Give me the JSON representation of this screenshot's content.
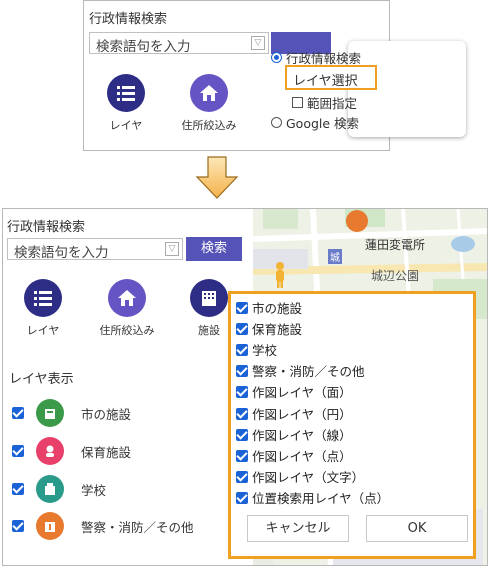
{
  "top": {
    "title": "行政情報検索",
    "search_placeholder": "検索語句を入力",
    "buttons": [
      {
        "label": "レイヤ",
        "icon": "list-icon"
      },
      {
        "label": "住所絞込み",
        "icon": "home-icon"
      }
    ],
    "options": [
      {
        "label": "行政情報検索",
        "type": "radio",
        "selected": true
      },
      {
        "label": "レイヤ選択",
        "type": "item",
        "highlighted": true
      },
      {
        "label": "範囲指定",
        "type": "checkbox",
        "checked": false
      },
      {
        "label": "Google 検索",
        "type": "radio",
        "selected": false
      }
    ]
  },
  "bottom": {
    "title": "行政情報検索",
    "search_placeholder": "検索語句を入力",
    "search_button": "検索",
    "buttons": [
      {
        "label": "レイヤ",
        "icon": "list-icon"
      },
      {
        "label": "住所絞込み",
        "icon": "home-icon"
      },
      {
        "label": "施設",
        "icon": "building-icon"
      }
    ],
    "layer_section_title": "レイヤ表示",
    "layers": [
      {
        "label": "市の施設",
        "checked": true,
        "icon": "city-facility-icon",
        "color": "#3a9a4a"
      },
      {
        "label": "保育施設",
        "checked": true,
        "icon": "childcare-icon",
        "color": "#e8406a"
      },
      {
        "label": "学校",
        "checked": true,
        "icon": "school-icon",
        "color": "#2a9a8a"
      },
      {
        "label": "警察・消防／その他",
        "checked": true,
        "icon": "police-fire-icon",
        "color": "#e87a30"
      }
    ],
    "map_labels": [
      "蓮田変電所",
      "城",
      "城辺公園"
    ],
    "popup": {
      "items": [
        "市の施設",
        "保育施設",
        "学校",
        "警察・消防／その他",
        "作図レイヤ（面）",
        "作図レイヤ（円）",
        "作図レイヤ（線）",
        "作図レイヤ（点）",
        "作図レイヤ（文字）",
        "位置検索用レイヤ（点）"
      ],
      "cancel_label": "キャンセル",
      "ok_label": "OK"
    }
  },
  "colors": {
    "accent_button": "#5552b8",
    "icon_dark": "#2d2d86",
    "icon_purple": "#6454c4",
    "highlight": "#f0a020",
    "checkbox": "#1a62d6"
  }
}
